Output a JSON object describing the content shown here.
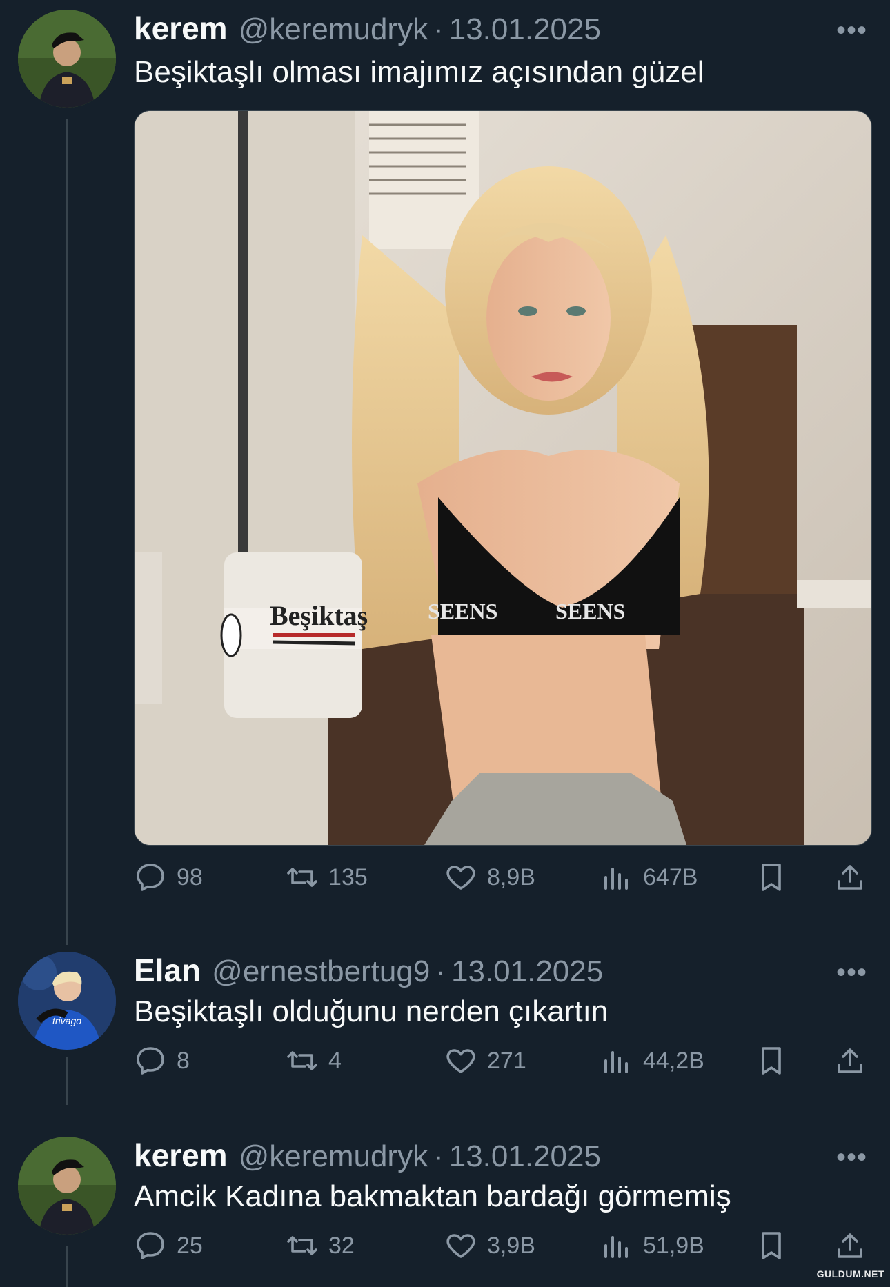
{
  "tweets": [
    {
      "name": "kerem",
      "handle": "@keremudryk",
      "date": "13.01.2025",
      "text": "Beşiktaşlı olması imajımız açısından güzel",
      "replies": "98",
      "retweets": "135",
      "likes": "8,9B",
      "views": "647B",
      "media": {
        "mug_text": "Beşiktaş",
        "top_text": "SEENS",
        "description_icon": "photo"
      }
    },
    {
      "name": "Elan",
      "handle": "@ernestbertug9",
      "date": "13.01.2025",
      "text": "Beşiktaşlı olduğunu nerden çıkartın",
      "replies": "8",
      "retweets": "4",
      "likes": "271",
      "views": "44,2B",
      "avatar_badge": "trivago"
    },
    {
      "name": "kerem",
      "handle": "@keremudryk",
      "date": "13.01.2025",
      "text": "Amcik Kadına bakmaktan bardağı görmemiş",
      "replies": "25",
      "retweets": "32",
      "likes": "3,9B",
      "views": "51,9B"
    }
  ],
  "ui": {
    "dot": "·",
    "more": "•••"
  },
  "watermark": "GULDUM.NET",
  "colors": {
    "background": "#15202b",
    "text": "#f7f9f9",
    "muted": "#8b98a5",
    "line": "#38444d"
  }
}
